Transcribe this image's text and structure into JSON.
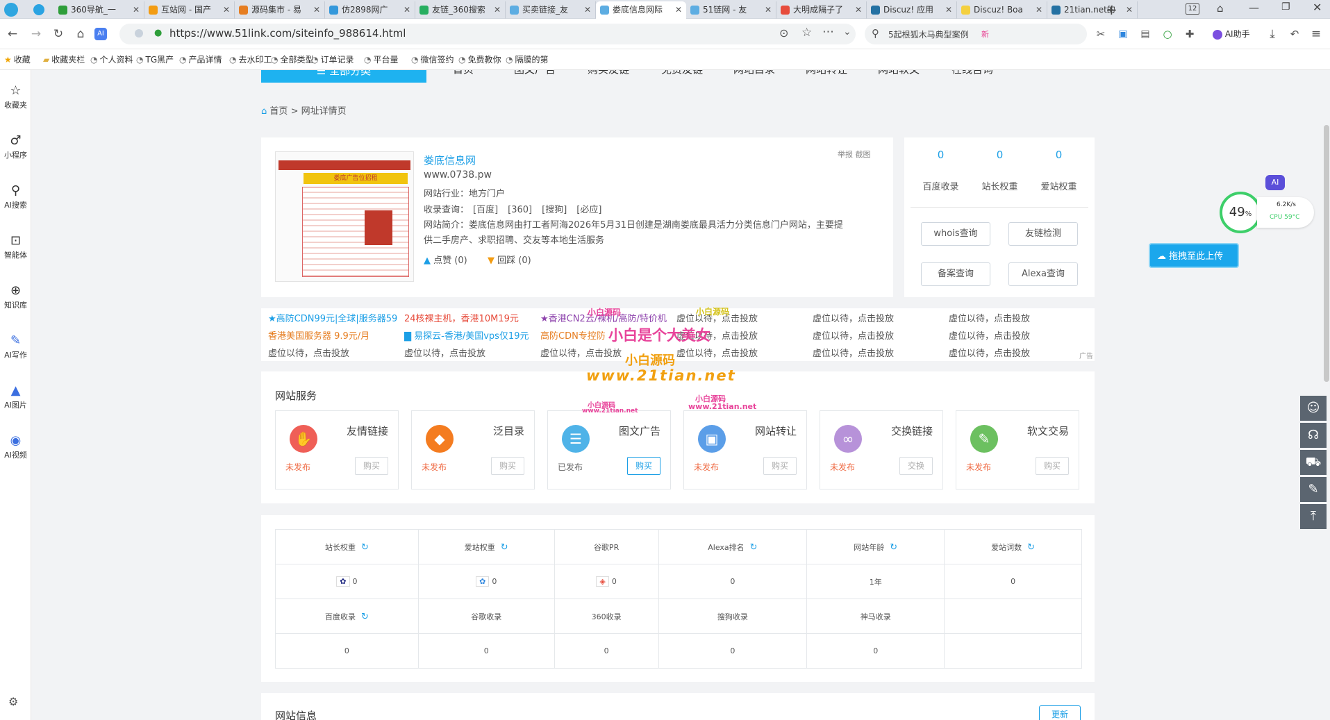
{
  "browser": {
    "tabs": [
      {
        "label": "360导航_一",
        "color": "#2e9e3a"
      },
      {
        "label": "互站网 - 国产",
        "color": "#f39c12"
      },
      {
        "label": "源码集市 - 易",
        "color": "#e67e22"
      },
      {
        "label": "仿2898网广",
        "color": "#3498db"
      },
      {
        "label": "友链_360搜索",
        "color": "#27ae60"
      },
      {
        "label": "买卖链接_友",
        "color": "#5dade2"
      },
      {
        "label": "娄底信息网际",
        "color": "#5dade2"
      },
      {
        "label": "51链网 - 友",
        "color": "#5dade2"
      },
      {
        "label": "大明成隔子了",
        "color": "#e74c3c"
      },
      {
        "label": "Discuz! 应用",
        "color": "#2471a3"
      },
      {
        "label": "Discuz! Boa",
        "color": "#f4d03f"
      },
      {
        "label": "21tian.net的",
        "color": "#2471a3"
      }
    ],
    "tab_count": "12",
    "url": "https://www.51link.com/siteinfo_988614.html",
    "search_text": "5起根狐木马典型案例",
    "search_badge": "新",
    "ai_assistant": "AI助手"
  },
  "bookmarks": [
    "收藏",
    "收藏夹栏",
    "个人资料",
    "TG黑产",
    "产品详情",
    "去水印工",
    "全部类型",
    "订单记录",
    "平台量",
    "微信签约",
    "免费教你",
    "隔膜的第"
  ],
  "sidebar": [
    {
      "label": "收藏夹",
      "icon": "star-icon",
      "glyph": "☆"
    },
    {
      "label": "小程序",
      "icon": "mini-program-icon",
      "glyph": "♂"
    },
    {
      "label": "AI搜索",
      "icon": "ai-search-icon",
      "glyph": "⚲"
    },
    {
      "label": "智能体",
      "icon": "agent-icon",
      "glyph": "⊡"
    },
    {
      "label": "知识库",
      "icon": "knowledge-icon",
      "glyph": "⊕"
    },
    {
      "label": "AI写作",
      "icon": "ai-write-icon",
      "glyph": "✎"
    },
    {
      "label": "AI图片",
      "icon": "ai-image-icon",
      "glyph": "▲"
    },
    {
      "label": "AI视频",
      "icon": "ai-video-icon",
      "glyph": "◉"
    }
  ],
  "site_nav": {
    "category_button": "全部分类",
    "items": [
      "首页",
      "图文广告",
      "购买友链",
      "免费友链",
      "网站目录",
      "网站转让",
      "网站软文",
      "在线咨询"
    ]
  },
  "breadcrumb": {
    "home": "首页",
    "sep": ">",
    "current": "网址详情页"
  },
  "site": {
    "name": "娄底信息网",
    "domain": "www.0738.pw",
    "industry_label": "网站行业：",
    "industry": "地方门户",
    "index_label": "收录查询：",
    "index_links": [
      "[百度]",
      "[360]",
      "[搜狗]",
      "[必应]"
    ],
    "intro_label": "网站简介：",
    "intro": "娄底信息网由打工者阿海2026年5月31日创建是湖南娄底最具活力分类信息门户网站，主要提供二手房产、求职招聘、交友等本地生活服务",
    "like": "点赞 (0)",
    "dislike": "回踩 (0)",
    "report": "举报 截图",
    "thumb_banner": "娄底广告位招租"
  },
  "weights": {
    "items": [
      {
        "value": "0",
        "label": "百度收录"
      },
      {
        "value": "0",
        "label": "站长权重"
      },
      {
        "value": "0",
        "label": "爱站权重"
      }
    ],
    "buttons": [
      "whois查询",
      "友链检测",
      "备案查询",
      "Alexa查询"
    ]
  },
  "ads": {
    "rows": [
      [
        {
          "text": "★高防CDN99元|全球|服务器59",
          "color": "#1c9fe6"
        },
        {
          "text": "24核裸主机，香港10M19元",
          "color": "#e74c3c"
        },
        {
          "text": "★香港CN2云/裸机/高防/特价机",
          "color": "#8e44ad"
        },
        {
          "text": "虚位以待，点击投放",
          "color": "#555"
        },
        {
          "text": "虚位以待，点击投放",
          "color": "#555"
        },
        {
          "text": "虚位以待，点击投放",
          "color": "#555"
        }
      ],
      [
        {
          "text": "香港美国服务器 9.9元/月",
          "color": "#e67e22"
        },
        {
          "text": "▇ 易探云-香港/美国vps仅19元",
          "color": "#1c9fe6"
        },
        {
          "text": "高防CDN专控防",
          "color": "#e67e22"
        },
        {
          "text": "虚位以待，点击投放",
          "color": "#555"
        },
        {
          "text": "虚位以待，点击投放",
          "color": "#555"
        },
        {
          "text": "虚位以待，点击投放",
          "color": "#555"
        }
      ],
      [
        {
          "text": "虚位以待，点击投放",
          "color": "#555"
        },
        {
          "text": "虚位以待，点击投放",
          "color": "#555"
        },
        {
          "text": "虚位以待，点击投放",
          "color": "#555"
        },
        {
          "text": "虚位以待，点击投放",
          "color": "#555"
        },
        {
          "text": "虚位以待，点击投放",
          "color": "#555"
        },
        {
          "text": "虚位以待，点击投放",
          "color": "#555"
        }
      ]
    ],
    "ad_tag": "广告"
  },
  "watermarks": {
    "line1": "小白是个大美女",
    "line2": "www.21tian.net",
    "small1": "小白源码",
    "small2": "www.21tian.net"
  },
  "services": {
    "title": "网站服务",
    "items": [
      {
        "name": "友情链接",
        "status": "未发布",
        "button": "购买",
        "color": "#ef5f57",
        "glyph": "✋",
        "icon": "handshake-icon",
        "active": false
      },
      {
        "name": "泛目录",
        "status": "未发布",
        "button": "购买",
        "color": "#f47c20",
        "glyph": "◆",
        "icon": "tag-icon",
        "active": false
      },
      {
        "name": "图文广告",
        "status": "已发布",
        "button": "购买",
        "color": "#4fb3e8",
        "glyph": "☰",
        "icon": "article-icon",
        "active": true
      },
      {
        "name": "网站转让",
        "status": "未发布",
        "button": "购买",
        "color": "#5b9ee8",
        "glyph": "▣",
        "icon": "image-icon",
        "active": false
      },
      {
        "name": "交换链接",
        "status": "未发布",
        "button": "交换",
        "color": "#b792d9",
        "glyph": "∞",
        "icon": "link-icon",
        "active": false
      },
      {
        "name": "软文交易",
        "status": "未发布",
        "button": "购买",
        "color": "#6cc060",
        "glyph": "✎",
        "icon": "edit-icon",
        "active": false
      }
    ]
  },
  "stats": {
    "row1_headers": [
      "站长权重",
      "爱站权重",
      "谷歌PR",
      "Alexa排名",
      "网站年龄",
      "爱站词数"
    ],
    "row1_values": [
      "0",
      "0",
      "0",
      "0",
      "1年",
      "0"
    ],
    "row2_headers": [
      "百度收录",
      "谷歌收录",
      "360收录",
      "搜狗收录",
      "神马收录"
    ],
    "row2_values": [
      "0",
      "0",
      "0",
      "0",
      "0"
    ]
  },
  "site_info": {
    "title": "网站信息",
    "button": "更新"
  },
  "widget": {
    "cpu_percent": "49",
    "percent_sign": "%",
    "speed": "6.2K/s",
    "cpu_temp": "CPU 59°C",
    "upload": "拖拽至此上传",
    "ai": "AI"
  }
}
